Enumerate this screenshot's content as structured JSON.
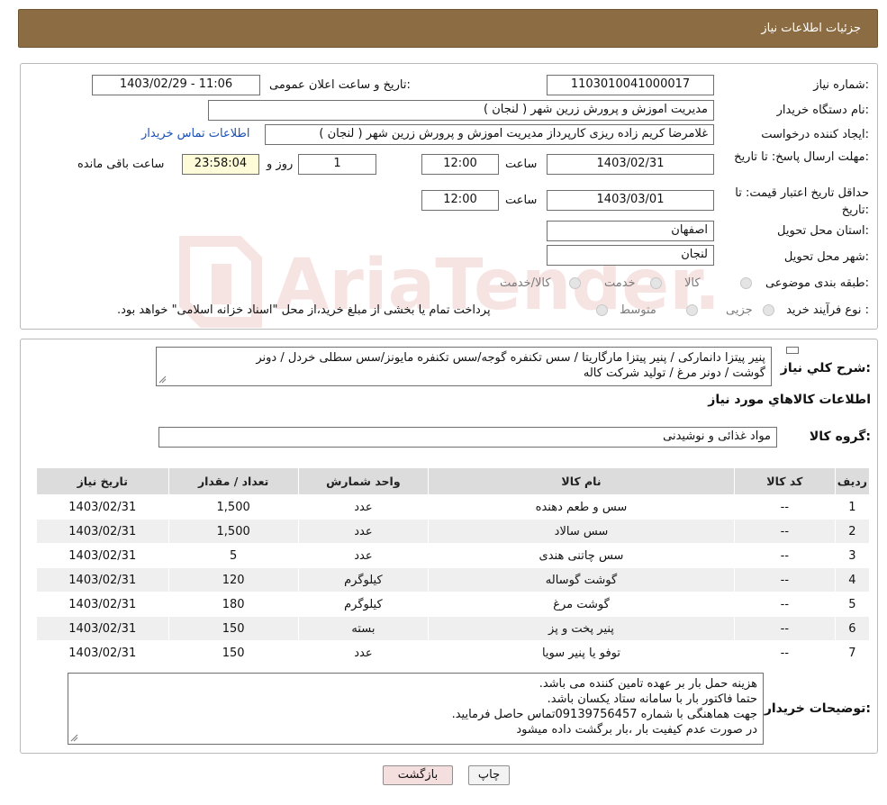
{
  "header": {
    "title": "جزئیات اطلاعات نیاز"
  },
  "form": {
    "need_number_label": "شماره نیاز:",
    "need_number": "1103010041000017",
    "announce_label": "تاریخ و ساعت اعلان عمومی:",
    "announce_value": "1403/02/29 - 11:06",
    "buyer_org_label": "نام دستگاه خریدار:",
    "buyer_org": "مدیریت اموزش و پرورش زرین شهر ( لنجان )",
    "creator_label": "ایجاد کننده درخواست:",
    "creator": "غلامرضا کریم زاده ریزی کارپرداز مدیریت اموزش و پرورش زرین شهر ( لنجان )",
    "contact_link": "اطلاعات تماس خریدار",
    "deadline_label": "مهلت ارسال پاسخ: تا تاریخ:",
    "deadline_date": "1403/02/31",
    "time_label": "ساعت",
    "deadline_time": "12:00",
    "days": "1",
    "days_label": "روز و",
    "remaining": "23:58:04",
    "remaining_label": "ساعت باقی مانده",
    "validity_label": "حداقل تاریخ اعتبار قیمت: تا تاریخ:",
    "validity_date": "1403/03/01",
    "validity_time": "12:00",
    "province_label": "استان محل تحویل:",
    "province": "اصفهان",
    "city_label": "شهر محل تحویل:",
    "city": "لنجان",
    "category_label": "طبقه بندی موضوعی:",
    "category_options": [
      "کالا",
      "خدمت",
      "کالا/خدمت"
    ],
    "process_label": "نوع فرآیند خرید :",
    "process_options": [
      "جزیی",
      "متوسط"
    ],
    "process_notice": "پرداخت تمام یا بخشی از مبلغ خرید،از محل \"اسناد خزانه اسلامی\" خواهد بود."
  },
  "summary": {
    "label": "شرح کلي نياز:",
    "line1": "پنیر پیتزا دانمارکی / پنیر پیتزا مارگاریتا / سس تکنفره گوجه/سس تکنفره مایونز/سس سطلی خردل / دونر",
    "line2": "گوشت / دونر مرغ / تولید شرکت کاله"
  },
  "goods": {
    "section_title": "اطلاعات کالاهاي مورد نياز",
    "group_label": "گروه کالا:",
    "group_value": "مواد غذائی و نوشیدنی",
    "columns": [
      "ردیف",
      "کد کالا",
      "نام کالا",
      "واحد شمارش",
      "تعداد / مقدار",
      "تاریخ نیاز"
    ],
    "rows": [
      [
        "1",
        "--",
        "سس و طعم دهنده",
        "عدد",
        "1,500",
        "1403/02/31"
      ],
      [
        "2",
        "--",
        "سس سالاد",
        "عدد",
        "1,500",
        "1403/02/31"
      ],
      [
        "3",
        "--",
        "سس چاتنی هندی",
        "عدد",
        "5",
        "1403/02/31"
      ],
      [
        "4",
        "--",
        "گوشت گوساله",
        "کیلوگرم",
        "120",
        "1403/02/31"
      ],
      [
        "5",
        "--",
        "گوشت مرغ",
        "کیلوگرم",
        "180",
        "1403/02/31"
      ],
      [
        "6",
        "--",
        "پنیر پخت و پز",
        "بسته",
        "150",
        "1403/02/31"
      ],
      [
        "7",
        "--",
        "توفو یا پنیر سویا",
        "عدد",
        "150",
        "1403/02/31"
      ]
    ]
  },
  "buyer_notes": {
    "label": "توضیحات خریدار:",
    "lines": [
      "هزینه حمل بار بر عهده تامین کننده می باشد.",
      "حتما فاکتور بار با سامانه ستاد یکسان باشد.",
      "جهت هماهنگی با شماره 09139756457تماس حاصل فرمایید.",
      "در صورت عدم کیفیت بار ،بار برگشت داده میشود"
    ]
  },
  "buttons": {
    "print": "چاپ",
    "back": "بازگشت"
  },
  "watermark": {
    "text": "AriaTender.neT"
  },
  "colors": {
    "header_bg": "#8c6c43",
    "link": "#1a50b8",
    "back_button_bg": "#f5dede"
  }
}
